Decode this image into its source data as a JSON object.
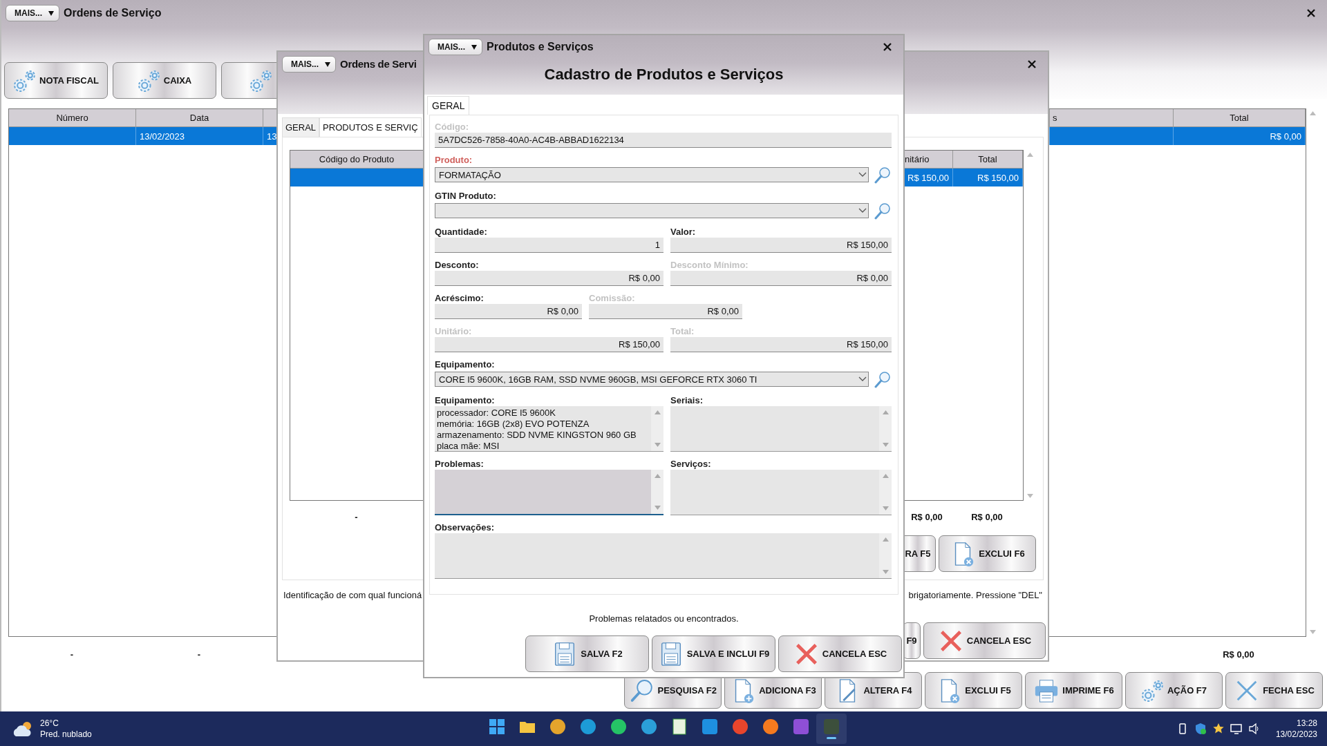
{
  "main_window": {
    "menu_button": "MAIS...",
    "title": "Ordens de Serviço",
    "toolbar": [
      {
        "kind": "gear",
        "label": "NOTA FISCAL"
      },
      {
        "kind": "gear",
        "label": "CAIXA"
      },
      {
        "kind": "gear"
      }
    ],
    "table": {
      "columns": [
        "Número",
        "Data",
        "s",
        "Total"
      ],
      "rows": [
        {
          "selected": true,
          "data": "13/02/2023",
          "column_3": "13",
          "total": "R$ 0,00"
        }
      ]
    },
    "totals": [
      "-",
      "-",
      "R$ 0,00"
    ],
    "actions": [
      {
        "kind": "search",
        "label": "PESQUISA F2"
      },
      {
        "kind": "add",
        "label": "ADICIONA F3"
      },
      {
        "kind": "edit",
        "label": "ALTERA F4"
      },
      {
        "kind": "delete",
        "label": "EXCLUI F5"
      },
      {
        "kind": "print",
        "label": "IMPRIME F6"
      },
      {
        "kind": "gear",
        "label": "AÇÃO F7"
      },
      {
        "kind": "close",
        "label": "FECHA ESC"
      }
    ]
  },
  "order_window": {
    "menu_button": "MAIS...",
    "title": "Ordens de Servi",
    "tabs": [
      {
        "label": "GERAL",
        "selected": false
      },
      {
        "label": "PRODUTOS E SERVIÇ",
        "selected": true
      }
    ],
    "table": {
      "columns": [
        "Código do Produto",
        "nitário",
        "Total"
      ],
      "rows": [
        {
          "selected": true,
          "unit": "R$ 150,00",
          "total": "R$ 150,00"
        }
      ]
    },
    "totals": [
      "-",
      "R$ 0,00",
      "R$ 0,00"
    ],
    "buttons": [
      {
        "kind": "plain",
        "label": "RA F5"
      },
      {
        "kind": "delete",
        "label": "EXCLUI F6"
      }
    ],
    "hints": [
      "Identificação de com qual funcioná",
      "brigatoriamente. Pressione \"DEL\""
    ],
    "bottom_buttons": [
      {
        "kind": "plain",
        "label": "F9"
      },
      {
        "kind": "cancel",
        "label": "CANCELA ESC"
      }
    ]
  },
  "dialog": {
    "menu_button": "MAIS...",
    "title": "Produtos e Serviços",
    "heading": "Cadastro de Produtos e Serviços",
    "tabs": [
      {
        "label": "GERAL",
        "selected": true
      }
    ],
    "form": [
      [
        {
          "kind": "text",
          "label": "Código:",
          "value": "5A7DC526-7858-40A0-AC4B-ABBAD1622134",
          "disabled": true,
          "required": false,
          "focused": false
        }
      ],
      [
        {
          "kind": "combo",
          "label": "Produto:",
          "value": "FORMATAÇÃO",
          "disabled": false,
          "required": true,
          "focused": false
        }
      ],
      [
        {
          "kind": "combo",
          "label": "GTIN Produto:",
          "disabled": false,
          "required": false,
          "focused": false
        }
      ],
      [
        {
          "kind": "number",
          "label": "Quantidade:",
          "value": "1",
          "disabled": false,
          "required": false,
          "focused": false
        },
        {
          "kind": "number",
          "label": "Valor:",
          "value": "R$ 150,00",
          "disabled": false,
          "required": false,
          "focused": false
        }
      ],
      [
        {
          "kind": "number",
          "label": "Desconto:",
          "value": "R$ 0,00",
          "disabled": false,
          "required": false,
          "focused": false
        },
        {
          "kind": "number",
          "label": "Desconto Mínimo:",
          "value": "R$ 0,00",
          "disabled": true,
          "required": false,
          "focused": false
        }
      ],
      [
        {
          "kind": "number",
          "label": "Acréscimo:",
          "value": "R$ 0,00",
          "disabled": false,
          "required": false,
          "focused": false
        },
        {
          "kind": "number",
          "label": "Comissão:",
          "value": "R$ 0,00",
          "disabled": true,
          "required": false,
          "focused": false
        }
      ],
      [
        {
          "kind": "number",
          "label": "Unitário:",
          "value": "R$ 150,00",
          "disabled": true,
          "required": false,
          "focused": false
        },
        {
          "kind": "number",
          "label": "Total:",
          "value": "R$ 150,00",
          "disabled": true,
          "required": false,
          "focused": false
        }
      ],
      [
        {
          "kind": "combo",
          "label": "Equipamento:",
          "value": "CORE I5 9600K, 16GB RAM, SSD NVME 960GB, MSI GEFORCE RTX 3060 TI",
          "disabled": false,
          "required": false,
          "focused": false
        }
      ],
      [
        {
          "kind": "memo",
          "label": "Equipamento:",
          "value": "processador: CORE I5 9600K\nmemória: 16GB (2x8) EVO POTENZA\narmazenamento: SDD NVME KINGSTON 960 GB\nplaca mãe: MSI",
          "disabled": false,
          "required": false,
          "focused": false
        },
        {
          "kind": "memo",
          "label": "Seriais:",
          "disabled": false,
          "required": false,
          "focused": false
        }
      ],
      [
        {
          "kind": "memo",
          "label": "Problemas:",
          "disabled": false,
          "required": false,
          "focused": true
        },
        {
          "kind": "memo",
          "label": "Serviços:",
          "disabled": false,
          "required": false,
          "focused": false
        }
      ],
      [
        {
          "kind": "memo",
          "label": "Observações:",
          "disabled": false,
          "required": false,
          "focused": false
        }
      ]
    ],
    "hint": "Problemas relatados ou encontrados.",
    "buttons": [
      {
        "kind": "save",
        "label": "SALVA F2"
      },
      {
        "kind": "save",
        "label": "SALVA E INCLUI F9"
      },
      {
        "kind": "cancel",
        "label": "CANCELA ESC"
      }
    ]
  },
  "taskbar": {
    "weather": {
      "temperature": "26°C",
      "forecast": "Pred. nublado"
    },
    "apps": [
      {
        "kind": "start",
        "active": false
      },
      {
        "kind": "folder",
        "active": false
      },
      {
        "kind": "circle",
        "color": "#e4a42c",
        "active": false
      },
      {
        "kind": "circle",
        "color": "#1d9bd7",
        "active": false
      },
      {
        "kind": "circle",
        "color": "#25c466",
        "active": false
      },
      {
        "kind": "circle",
        "color": "#2b9fd9",
        "active": false
      },
      {
        "kind": "document",
        "active": false
      },
      {
        "kind": "square",
        "color": "#1e90e0",
        "active": false
      },
      {
        "kind": "circle",
        "color": "#e8452c",
        "active": false
      },
      {
        "kind": "circle",
        "color": "#f57a1f",
        "active": false
      },
      {
        "kind": "square",
        "color": "#8e4fd6",
        "active": false
      },
      {
        "kind": "square",
        "color": "#3c4f3c",
        "active": true
      }
    ],
    "tray": [
      {
        "kind": "drive"
      },
      {
        "kind": "shield"
      },
      {
        "kind": "star"
      },
      {
        "kind": "monitor"
      },
      {
        "kind": "speaker"
      }
    ],
    "time": "13:28",
    "date": "13/02/2023"
  }
}
